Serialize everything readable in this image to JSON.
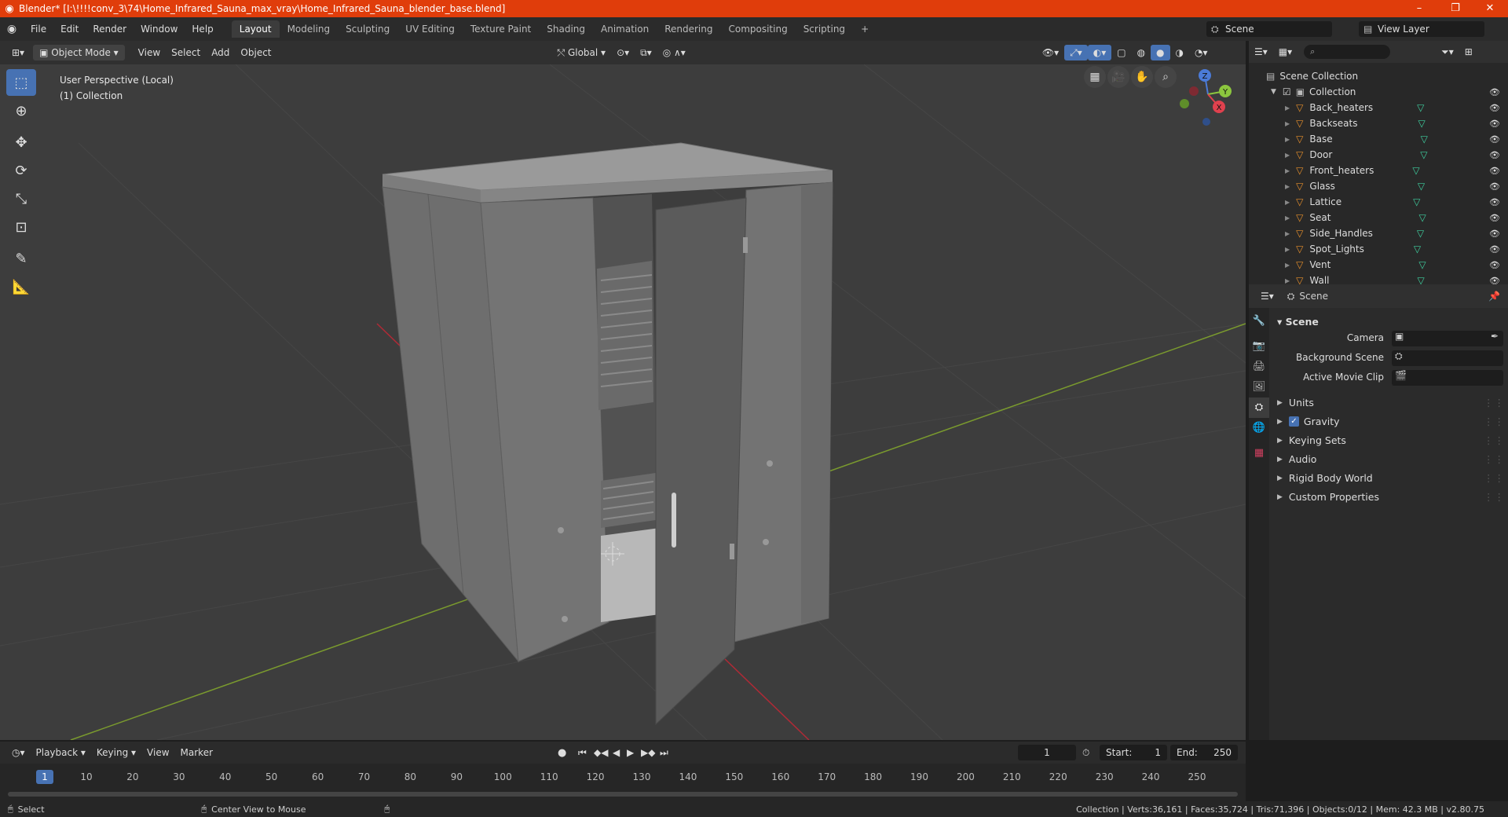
{
  "window": {
    "title": "Blender* [I:\\!!!!conv_3\\74\\Home_Infrared_Sauna_max_vray\\Home_Infrared_Sauna_blender_base.blend]",
    "minimize": "–",
    "maximize": "❐",
    "close": "✕"
  },
  "menus": [
    "File",
    "Edit",
    "Render",
    "Window",
    "Help"
  ],
  "workspaces": [
    "Layout",
    "Modeling",
    "Sculpting",
    "UV Editing",
    "Texture Paint",
    "Shading",
    "Animation",
    "Rendering",
    "Compositing",
    "Scripting"
  ],
  "add_workspace": "+",
  "scene_field": "Scene",
  "view_layer_field": "View Layer",
  "viewport_header": {
    "mode": "Object Mode",
    "menus": [
      "View",
      "Select",
      "Add",
      "Object"
    ],
    "transform_orientation": "Global"
  },
  "viewport": {
    "info_line1": "User Perspective (Local)",
    "info_line2": "(1) Collection",
    "gizmo": {
      "x": "X",
      "y": "Y",
      "z": "Z"
    }
  },
  "outliner": {
    "root": "Scene Collection",
    "collection": "Collection",
    "objects": [
      "Back_heaters",
      "Backseats",
      "Base",
      "Door",
      "Front_heaters",
      "Glass",
      "Lattice",
      "Seat",
      "Side_Handles",
      "Spot_Lights",
      "Vent",
      "Wall"
    ]
  },
  "properties": {
    "context": "Scene",
    "section": "Scene",
    "fields": {
      "camera": "Camera",
      "background_scene": "Background Scene",
      "active_movie_clip": "Active Movie Clip"
    },
    "panels": [
      "Units",
      "Gravity",
      "Keying Sets",
      "Audio",
      "Rigid Body World",
      "Custom Properties"
    ],
    "gravity_checked": true
  },
  "timeline": {
    "menus": [
      "Playback",
      "Keying",
      "View",
      "Marker"
    ],
    "current_frame": "1",
    "start_label": "Start:",
    "start": "1",
    "end_label": "End:",
    "end": "250",
    "ticks": [
      "1",
      "10",
      "20",
      "30",
      "40",
      "50",
      "60",
      "70",
      "80",
      "90",
      "100",
      "110",
      "120",
      "130",
      "140",
      "150",
      "160",
      "170",
      "180",
      "190",
      "200",
      "210",
      "220",
      "230",
      "240",
      "250"
    ]
  },
  "statusbar": {
    "select": "Select",
    "center_view": "Center View to Mouse",
    "stats": "Collection | Verts:36,161 | Faces:35,724 | Tris:71,396 | Objects:0/12 | Mem: 42.3 MB | v2.80.75"
  },
  "colors": {
    "accent": "#4772b3",
    "titlebar": "#e03d0b",
    "object_icon": "#e8902b",
    "mesh_icon": "#3fd0a0"
  }
}
